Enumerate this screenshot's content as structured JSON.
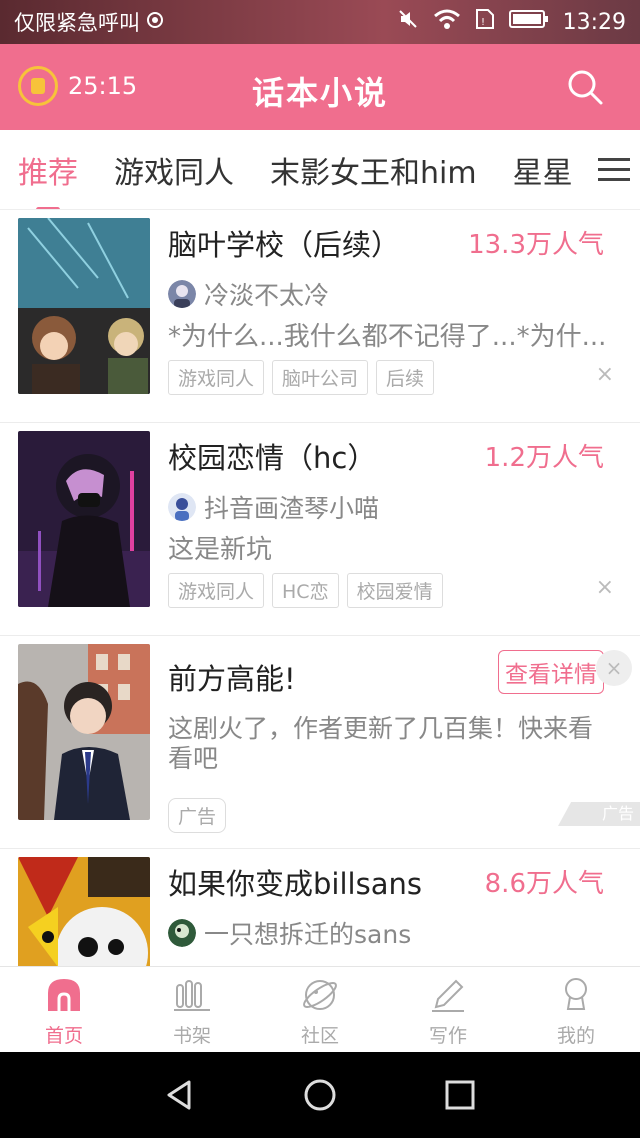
{
  "status_bar": {
    "carrier": "仅限紧急呼叫",
    "time": "13:29"
  },
  "header": {
    "timer": "25:15",
    "title": "话本小说"
  },
  "tabs": [
    {
      "label": "推荐",
      "active": true
    },
    {
      "label": "游戏同人",
      "active": false
    },
    {
      "label": "末影女王和him",
      "active": false
    },
    {
      "label": "星星",
      "active": false
    }
  ],
  "stories": [
    {
      "title": "脑叶学校（后续）",
      "popularity": "13.3万人气",
      "author": "冷淡不太冷",
      "description": "*为什么...我什么都不记得了...*为什...",
      "tags": [
        "游戏同人",
        "脑叶公司",
        "后续"
      ],
      "close": "×"
    },
    {
      "title": "校园恋情（hc）",
      "popularity": "1.2万人气",
      "author": "抖音画渣琴小喵",
      "description": "这是新坑",
      "tags": [
        "游戏同人",
        "HC恋",
        "校园爱情"
      ],
      "close": "×"
    }
  ],
  "ad": {
    "title": "前方高能!",
    "detail_button": "查看详情",
    "description": "这剧火了，作者更新了几百集！快来看看吧",
    "tag": "广告",
    "badge": "广告",
    "close": "×"
  },
  "story4": {
    "title": "如果你变成billsans",
    "popularity": "8.6万人气",
    "author": "一只想拆迁的sans"
  },
  "bottom_nav": [
    {
      "label": "首页",
      "icon": "home-icon",
      "active": true
    },
    {
      "label": "书架",
      "icon": "bookshelf-icon",
      "active": false
    },
    {
      "label": "社区",
      "icon": "planet-icon",
      "active": false
    },
    {
      "label": "写作",
      "icon": "pen-icon",
      "active": false
    },
    {
      "label": "我的",
      "icon": "profile-icon",
      "active": false
    }
  ],
  "colors": {
    "accent": "#f06e8e"
  }
}
